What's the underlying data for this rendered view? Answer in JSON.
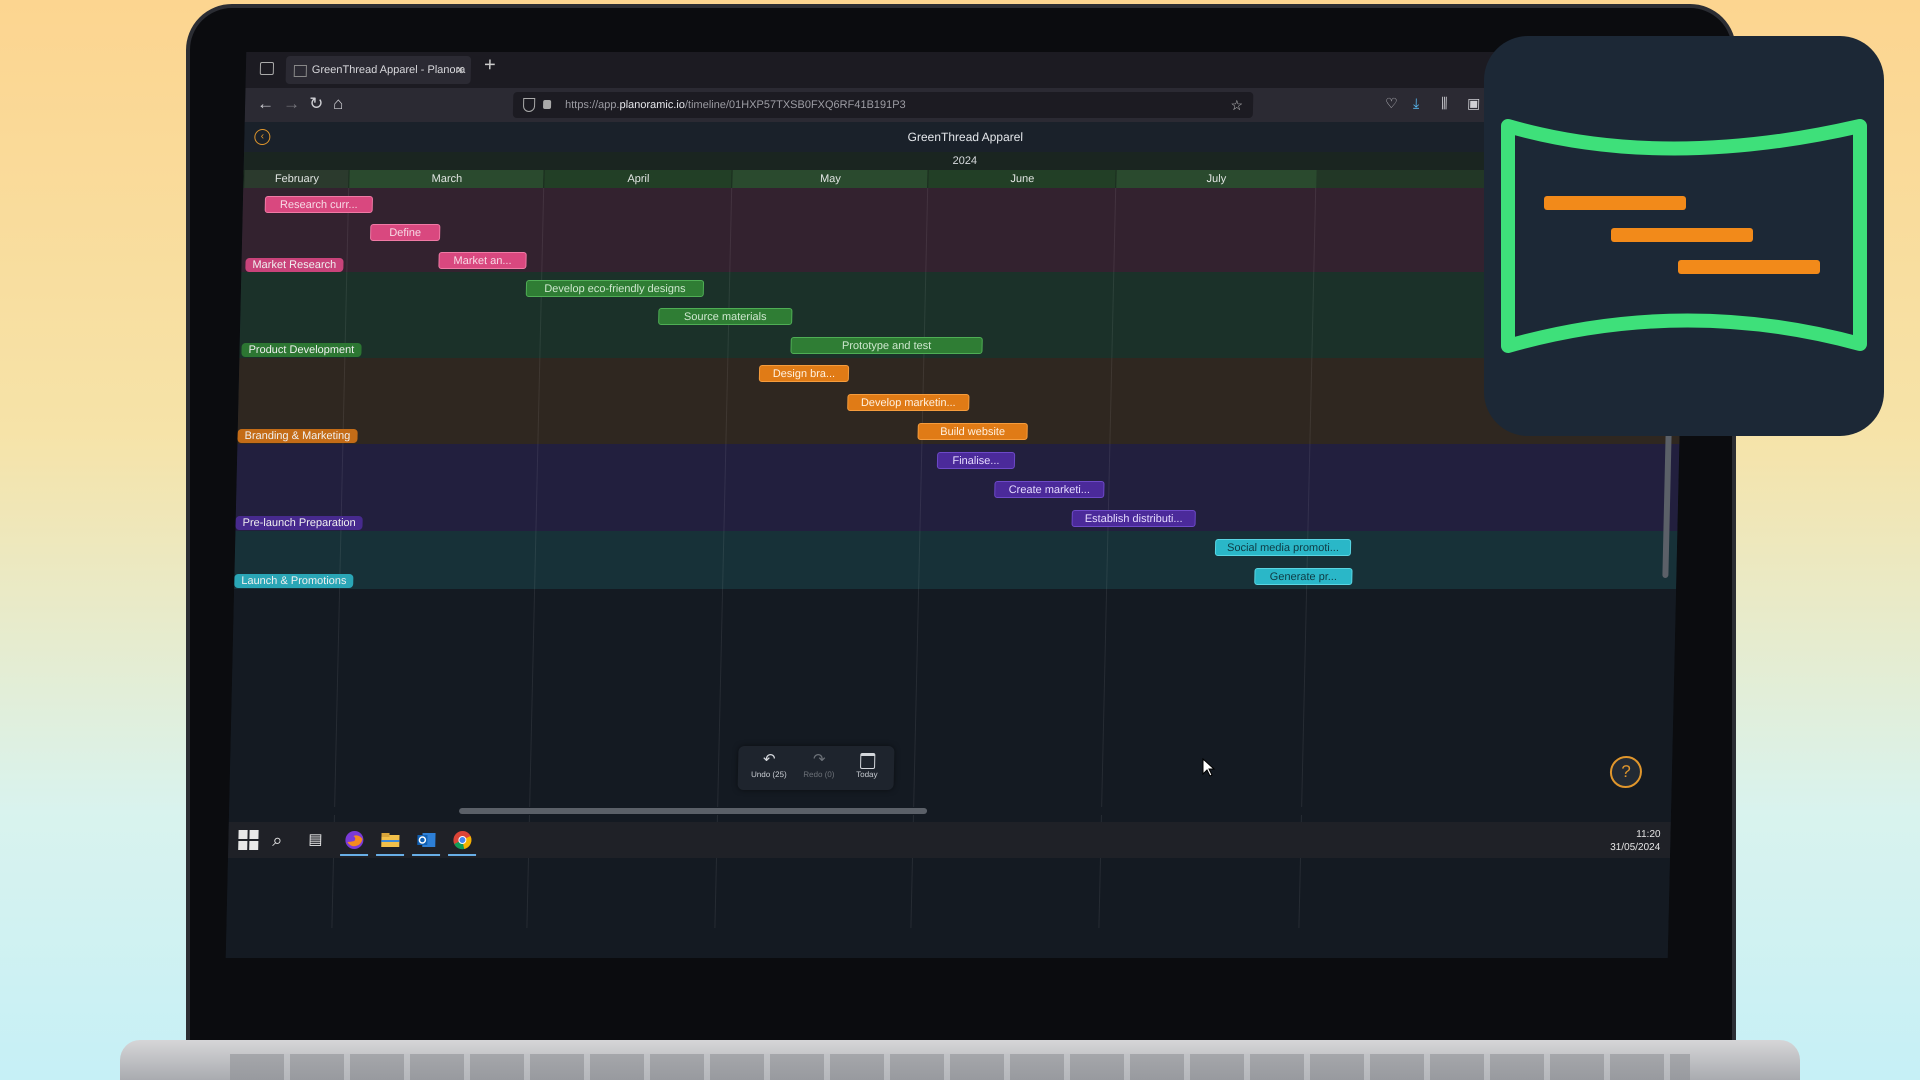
{
  "browser": {
    "tab_title": "GreenThread Apparel - Planora",
    "new_tab": "+",
    "url_prefix": "https://app.",
    "url_domain": "planoramic.io",
    "url_path": "/timeline/01HXP57TXSB0FXQ6RF41B191P3"
  },
  "app": {
    "title": "GreenThread Apparel",
    "year": "2024",
    "months": [
      "February",
      "March",
      "April",
      "May",
      "June",
      "July"
    ]
  },
  "groups": [
    {
      "label": "Market Research",
      "color": "#d9487f",
      "tasks": [
        "Research curr...",
        "Define",
        "Market an..."
      ]
    },
    {
      "label": "Product Development",
      "color": "#2f7d34",
      "tasks": [
        "Develop eco-friendly designs",
        "Source materials",
        "Prototype and test"
      ]
    },
    {
      "label": "Branding & Marketing",
      "color": "#e07b16",
      "tasks": [
        "Design bra...",
        "Develop marketin...",
        "Build website"
      ]
    },
    {
      "label": "Pre-launch Preparation",
      "color": "#4b2a9a",
      "tasks": [
        "Finalise...",
        "Create marketi...",
        "Establish distributi..."
      ]
    },
    {
      "label": "Launch & Promotions",
      "color": "#2ab7c8",
      "tasks": [
        "Social media promoti...",
        "Generate pr..."
      ]
    }
  ],
  "toolbar": {
    "undo_label": "Undo (25)",
    "redo_label": "Redo (0)",
    "today_label": "Today"
  },
  "help_label": "?",
  "taskbar": {
    "time": "11:20",
    "date": "31/05/2024"
  },
  "icons": {
    "back": "arrow-left-icon",
    "forward": "arrow-right-icon",
    "reload": "reload-icon",
    "home": "home-icon",
    "bookmark": "star-icon"
  },
  "colors": {
    "accent_orange": "#e0962c",
    "logo_green": "#3ee07a",
    "logo_orange": "#f28a1a",
    "logo_bg": "#1c2836"
  }
}
